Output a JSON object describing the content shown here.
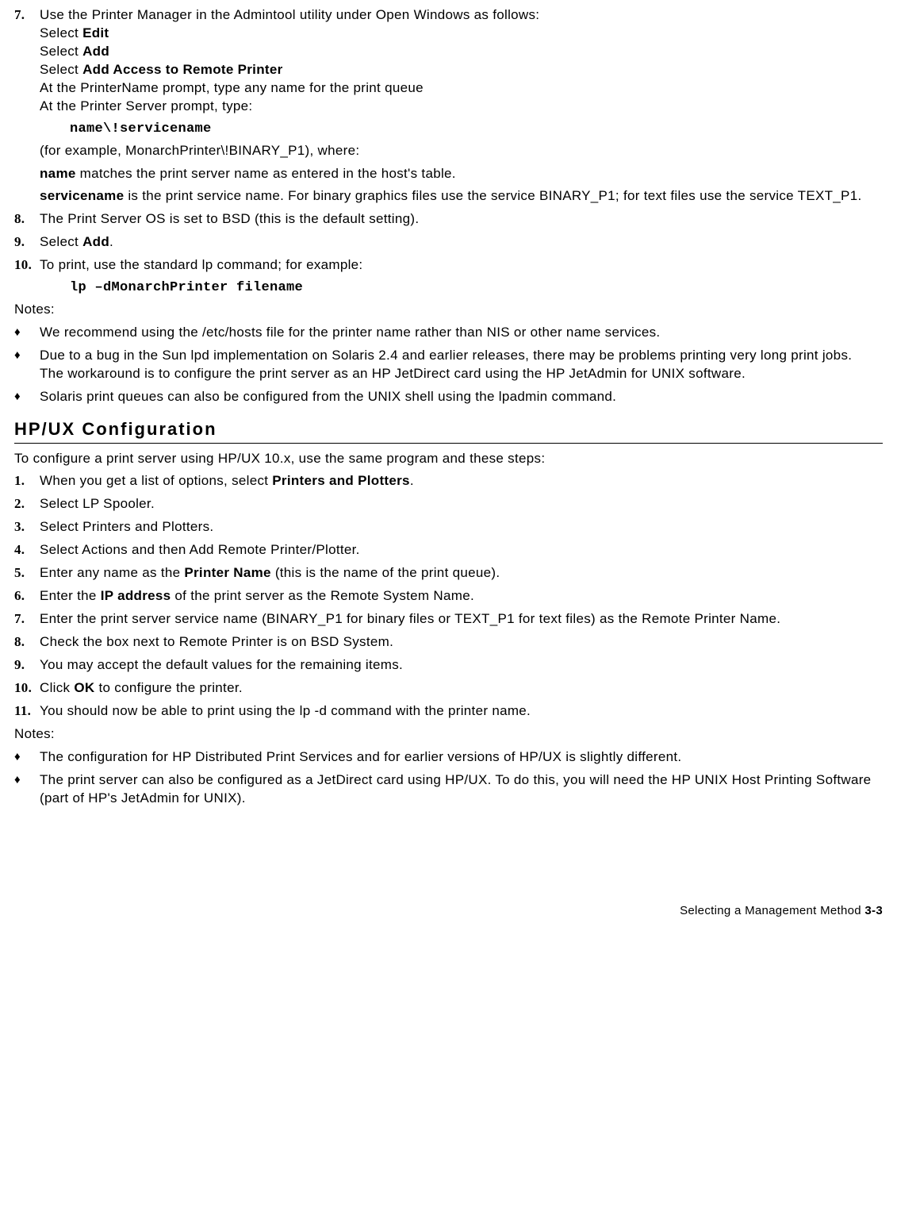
{
  "section_a": {
    "item7": {
      "num": "7.",
      "line1": "Use the Printer Manager in the Admintool utility under Open Windows as follows:",
      "line2a": "Select ",
      "line2b": "Edit",
      "line3a": "Select ",
      "line3b": "Add",
      "line4a": "Select ",
      "line4b": "Add Access to Remote Printer",
      "line5": "At the  PrinterName prompt, type any name for the print queue",
      "line6": "At the Printer Server prompt, type:"
    },
    "code1": "name\\!servicename",
    "para1": "(for example, MonarchPrinter\\!BINARY_P1), where:",
    "para2a": "name",
    "para2b": " matches the print server name as entered in the host's table.",
    "para3a": "servicename",
    "para3b": " is the print service name.  For binary graphics files use the service BINARY_P1; for text files use the service TEXT_P1.",
    "item8": {
      "num": "8.",
      "text": "The Print Server OS is set to BSD (this is the default setting)."
    },
    "item9": {
      "num": "9.",
      "texta": "Select ",
      "textb": "Add",
      "textc": "."
    },
    "item10": {
      "num": "10.",
      "text": "To print, use the standard lp command; for example:"
    },
    "code2": "lp –dMonarchPrinter  filename",
    "notes_label": "Notes:",
    "note1": "We recommend using the /etc/hosts file for the printer name rather than NIS or other name services.",
    "note2a": "Due to a bug in the Sun lpd implementation on Solaris 2.4 and earlier releases, there may be problems printing very long print jobs.",
    "note2b": "The workaround is to configure the print server as an HP JetDirect card using the HP JetAdmin for UNIX software.",
    "note3": "Solaris print queues can also be configured from the UNIX shell using the lpadmin command."
  },
  "heading_hpux": "HP/UX Configuration",
  "section_b": {
    "intro": "To configure a print server using HP/UX 10.x, use the same program and these steps:",
    "item1": {
      "num": "1.",
      "texta": "When you get a list of options, select ",
      "textb": "Printers and Plotters",
      "textc": "."
    },
    "item2": {
      "num": "2.",
      "text": "Select LP Spooler."
    },
    "item3": {
      "num": "3.",
      "text": "Select Printers and Plotters."
    },
    "item4": {
      "num": "4.",
      "text": "Select Actions and then Add Remote Printer/Plotter."
    },
    "item5": {
      "num": "5.",
      "texta": "Enter any name as the ",
      "textb": "Printer Name",
      "textc": " (this is the name of the print queue)."
    },
    "item6": {
      "num": "6.",
      "texta": "Enter the ",
      "textb": "IP address",
      "textc": " of the print server as the Remote System Name."
    },
    "item7": {
      "num": "7.",
      "text": "Enter the print server service name (BINARY_P1 for binary files or TEXT_P1 for text files) as the Remote Printer Name."
    },
    "item8": {
      "num": "8.",
      "text": "Check the box next to Remote Printer is on BSD System."
    },
    "item9": {
      "num": "9.",
      "text": "You may accept the default values for the remaining items."
    },
    "item10": {
      "num": "10.",
      "texta": "Click ",
      "textb": "OK",
      "textc": " to configure the printer."
    },
    "item11": {
      "num": "11.",
      "text": "You should now be able to print using the lp -d command with the printer name."
    },
    "notes_label": "Notes:",
    "note1": "The configuration for HP Distributed Print Services and for earlier versions of HP/UX is slightly different.",
    "note2": "The print server can also be configured as a JetDirect card using HP/UX.  To do this, you will need the HP UNIX Host Printing Software (part of HP's JetAdmin for UNIX)."
  },
  "footer": {
    "text": "Selecting a Management Method  ",
    "page": "3-3"
  }
}
